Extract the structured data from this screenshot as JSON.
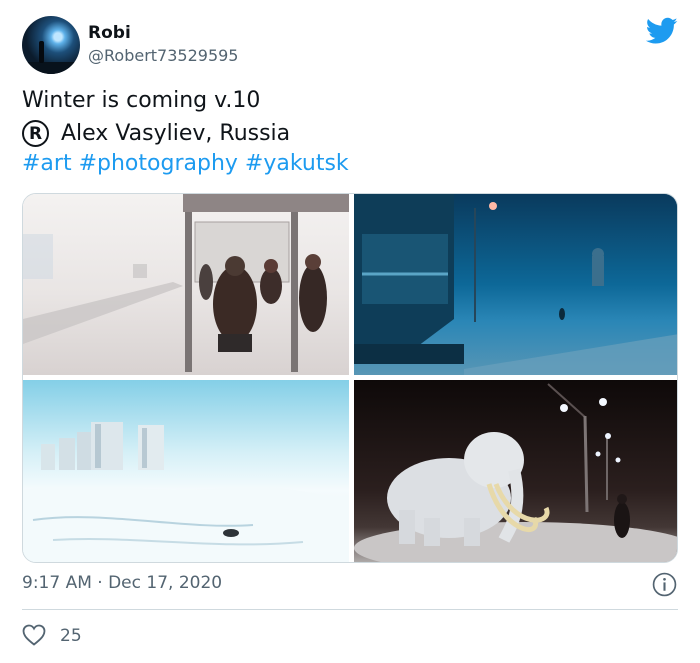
{
  "user": {
    "name": "Robi",
    "handle": "@Robert73529595",
    "avatar_icon": "avatar-photo"
  },
  "brand": {
    "icon": "twitter-bird-icon",
    "color": "#1d9bf0"
  },
  "tweet": {
    "line1": "Winter is coming v.10",
    "registered_symbol": "R",
    "line2": "Alex Vasyliev, Russia",
    "hashtags": [
      "#art",
      "#photography",
      "#yakutsk"
    ],
    "link_color": "#1d9bf0"
  },
  "media": {
    "photos": [
      "bus-stop-fog-photo",
      "blue-street-night-photo",
      "snowy-city-buildings-photo",
      "mammoth-statue-night-photo"
    ]
  },
  "meta": {
    "timestamp": "9:17 AM · Dec 17, 2020",
    "info_icon": "info-icon"
  },
  "actions": {
    "likes": "25",
    "like_icon": "heart-icon"
  }
}
